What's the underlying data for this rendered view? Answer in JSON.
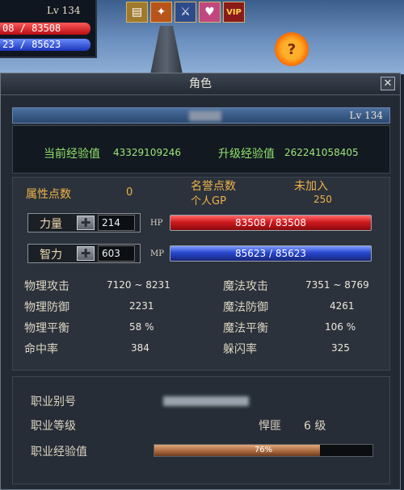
{
  "hud": {
    "level": "Lv 134",
    "hp": "08 / 83508",
    "mp": "23 / 85623",
    "buff_icons": [
      "scroll-buff-icon",
      "fire-buff-icon",
      "sword-buff-icon",
      "heart-buff-icon",
      "vip-buff-icon"
    ],
    "vip_label": "VIP"
  },
  "window": {
    "title": "角色",
    "close_label": "✕",
    "level": "Lv 134",
    "exp": {
      "current_label": "当前经验值",
      "current_value": "43329109246",
      "next_label": "升级经验值",
      "next_value": "262241058405"
    },
    "attributes": {
      "points_label": "属性点数",
      "points_value": "0",
      "honor_label": "名誉点数",
      "honor_value": "未加入",
      "gp_label": "个人GP",
      "gp_value": "250",
      "strength_label": "力量",
      "strength_value": "214",
      "intellect_label": "智力",
      "intellect_value": "603",
      "hp_label": "HP",
      "hp_value": "83508 / 83508",
      "mp_label": "MP",
      "mp_value": "85623 / 85623"
    },
    "combat": {
      "phys_attack_label": "物理攻击",
      "phys_attack_value": "7120 ~ 8231",
      "mag_attack_label": "魔法攻击",
      "mag_attack_value": "7351 ~ 8769",
      "phys_def_label": "物理防御",
      "phys_def_value": "2231",
      "mag_def_label": "魔法防御",
      "mag_def_value": "4261",
      "phys_balance_label": "物理平衡",
      "phys_balance_value": "58 %",
      "mag_balance_label": "魔法平衡",
      "mag_balance_value": "106 %",
      "hit_label": "命中率",
      "hit_value": "384",
      "dodge_label": "躲闪率",
      "dodge_value": "325"
    },
    "job": {
      "alias_label": "职业别号",
      "level_label": "职业等级",
      "level_name": "悍匪",
      "level_value": "6 级",
      "exp_label": "职业经验值",
      "exp_percent": "76%",
      "exp_fraction": 0.76
    }
  }
}
